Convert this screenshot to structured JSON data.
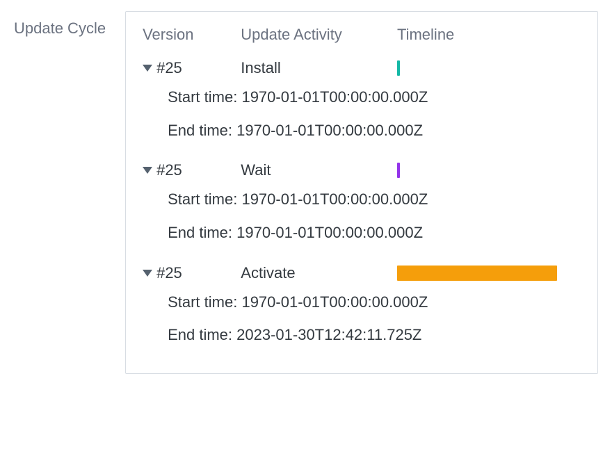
{
  "sideLabel": "Update Cycle",
  "headers": {
    "version": "Version",
    "activity": "Update Activity",
    "timeline": "Timeline"
  },
  "labels": {
    "start": "Start time:",
    "end": "End time:"
  },
  "rows": [
    {
      "version": "#25",
      "activity": "Install",
      "barClass": "bar-install",
      "start": "1970-01-01T00:00:00.000Z",
      "end": "1970-01-01T00:00:00.000Z"
    },
    {
      "version": "#25",
      "activity": "Wait",
      "barClass": "bar-wait",
      "start": "1970-01-01T00:00:00.000Z",
      "end": "1970-01-01T00:00:00.000Z"
    },
    {
      "version": "#25",
      "activity": "Activate",
      "barClass": "bar-activate",
      "start": "1970-01-01T00:00:00.000Z",
      "end": "2023-01-30T12:42:11.725Z"
    }
  ]
}
